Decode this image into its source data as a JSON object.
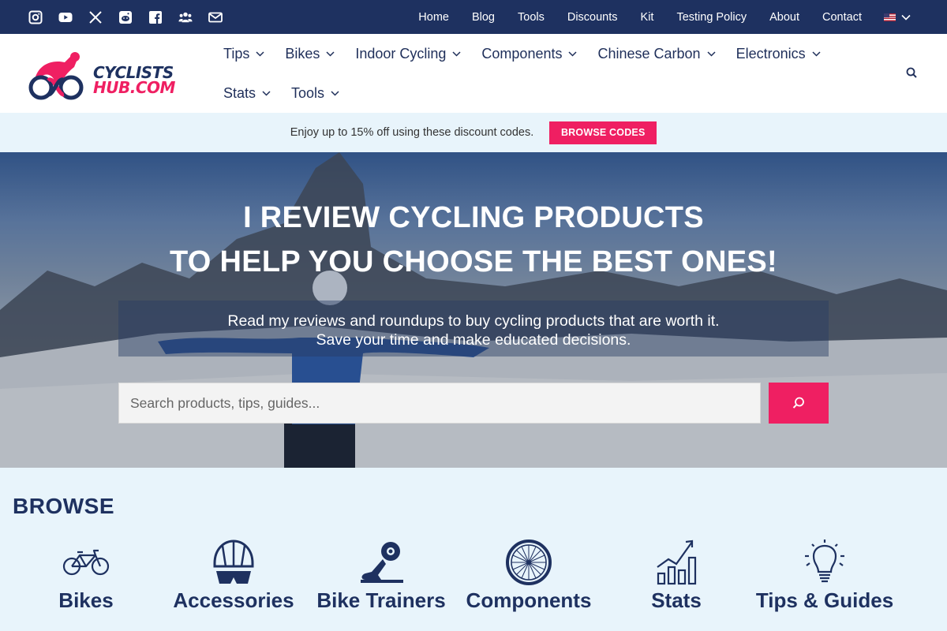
{
  "topbar": {
    "social_icons": [
      "instagram-icon",
      "youtube-icon",
      "x-icon",
      "reddit-icon",
      "facebook-icon",
      "group-icon",
      "email-icon"
    ],
    "nav": [
      "Home",
      "Blog",
      "Tools",
      "Discounts",
      "Kit",
      "Testing Policy",
      "About",
      "Contact"
    ],
    "language_icon": "us-flag-icon"
  },
  "header": {
    "logo_line1": "CYCLISTS",
    "logo_line2": "HUB.COM",
    "nav_row1": [
      "Tips",
      "Bikes",
      "Indoor Cycling",
      "Components",
      "Chinese Carbon",
      "Electronics"
    ],
    "nav_row2": [
      "Stats",
      "Tools"
    ]
  },
  "promo": {
    "text": "Enjoy up to 15% off using these discount codes.",
    "button": "BROWSE CODES"
  },
  "hero": {
    "title_line1": "I REVIEW CYCLING PRODUCTS",
    "title_line2": "TO HELP YOU CHOOSE THE BEST ONES!",
    "sub_line1": "Read my reviews and roundups to buy cycling products that are worth it.",
    "sub_line2": "Save your time and make educated decisions.",
    "search_placeholder": "Search products, tips, guides..."
  },
  "browse": {
    "title": "BROWSE",
    "categories": [
      {
        "label": "Bikes",
        "icon": "bike-icon"
      },
      {
        "label": "Accessories",
        "icon": "helmet-icon"
      },
      {
        "label": "Bike Trainers",
        "icon": "trainer-icon"
      },
      {
        "label": "Components",
        "icon": "wheel-icon"
      },
      {
        "label": "Stats",
        "icon": "chart-icon"
      },
      {
        "label": "Tips & Guides",
        "icon": "lightbulb-icon"
      }
    ]
  },
  "colors": {
    "navy": "#1e3160",
    "accent": "#ef1f62",
    "background": "#e8f4fb"
  }
}
